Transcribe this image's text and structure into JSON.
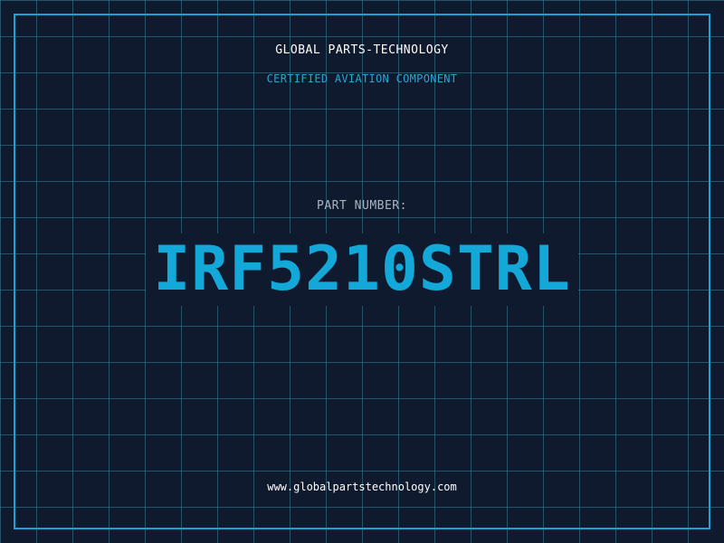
{
  "header": {
    "company": "GLOBAL PARTS-TECHNOLOGY",
    "subtitle": "CERTIFIED AVIATION COMPONENT"
  },
  "part": {
    "label": "PART NUMBER:",
    "number": "IRF5210STRL"
  },
  "footer": {
    "url": "www.globalpartstechnology.com"
  },
  "colors": {
    "background": "#0f1a2e",
    "grid": "#4696aa",
    "accent": "#14a8d8",
    "label": "#aab4c2",
    "text": "#ffffff"
  }
}
